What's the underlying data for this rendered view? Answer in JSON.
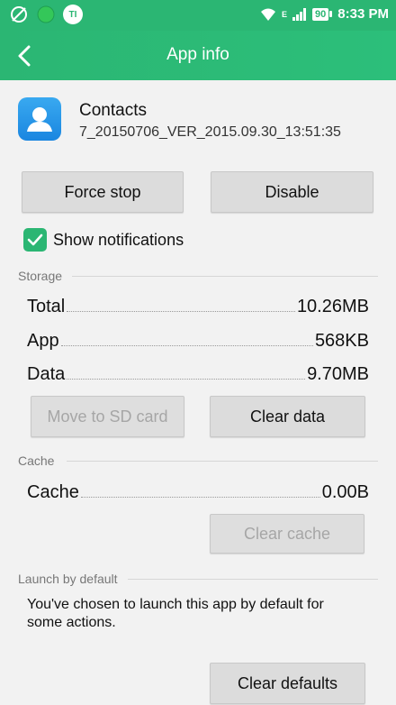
{
  "status_bar": {
    "battery": "90",
    "time": "8:33 PM",
    "network_label": "E",
    "icons": [
      "no-location-icon",
      "green-dot-icon",
      "ti-badge-icon",
      "wifi-icon",
      "signal-icon",
      "battery-icon"
    ],
    "ti_badge": "TI"
  },
  "app_bar": {
    "title": "App info",
    "back_icon": "chevron-left-icon"
  },
  "app": {
    "name": "Contacts",
    "version": "7_20150706_VER_2015.09.30_13:51:35",
    "icon": "contacts-app-icon"
  },
  "actions": {
    "force_stop": "Force stop",
    "disable": "Disable"
  },
  "notifications": {
    "label": "Show notifications",
    "checked": true
  },
  "storage": {
    "header": "Storage",
    "rows": [
      {
        "label": "Total",
        "value": "10.26MB"
      },
      {
        "label": "App",
        "value": "568KB"
      },
      {
        "label": "Data",
        "value": "9.70MB"
      }
    ],
    "move_to_sd": "Move to SD card",
    "clear_data": "Clear data"
  },
  "cache": {
    "header": "Cache",
    "label": "Cache",
    "value": "0.00B",
    "clear_cache": "Clear cache"
  },
  "launch_default": {
    "header": "Launch by default",
    "description": "You've chosen to launch this app by default for some actions.",
    "clear_defaults": "Clear defaults"
  },
  "colors": {
    "accent": "#2bb673",
    "app_icon": "#2a93e8"
  }
}
